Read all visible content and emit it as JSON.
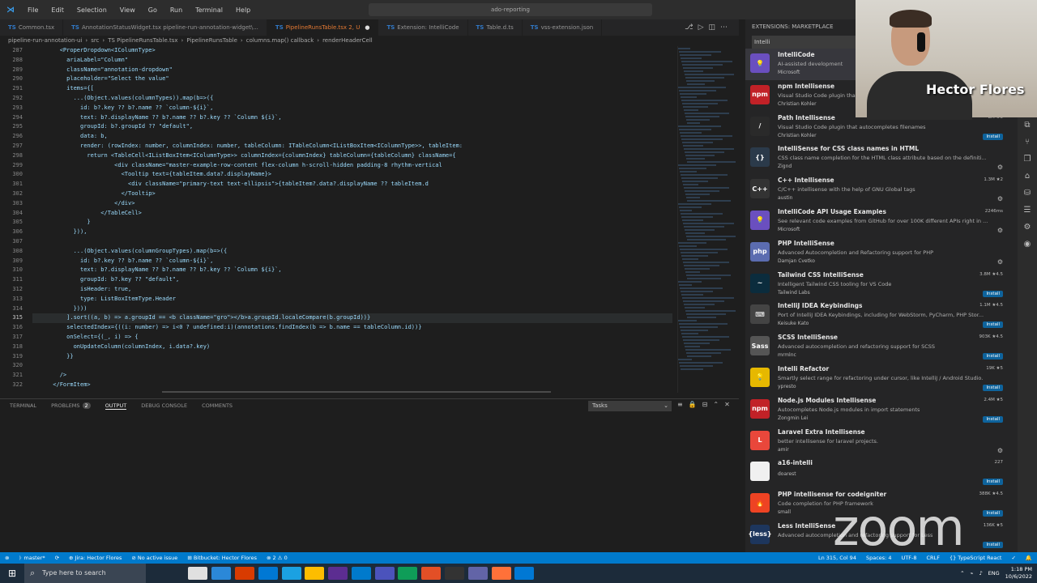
{
  "menubar": {
    "items": [
      "File",
      "Edit",
      "Selection",
      "View",
      "Go",
      "Run",
      "Terminal",
      "Help"
    ],
    "search": "ado-reporting",
    "nav": [
      "←",
      "→"
    ]
  },
  "tabs": [
    {
      "label": "Common.tsx",
      "state": "dot"
    },
    {
      "label": "AnnotationStatusWidget.tsx  pipeline-run-annotation-widget\\..."
    },
    {
      "label": "PipelineRunsTable.tsx 2, U",
      "active": true
    },
    {
      "label": "Extension: IntelliCode"
    },
    {
      "label": "Table.d.ts"
    },
    {
      "label": "vss-extension.json"
    }
  ],
  "breadcrumb": [
    "pipeline-run-annotation-ui",
    "›",
    "src",
    "›",
    "TS PipelineRunsTable.tsx",
    "›",
    "PipelineRunsTable",
    "›",
    "columns.map() callback",
    "›",
    "renderHeaderCell"
  ],
  "code_lines": [
    {
      "n": "287",
      "t": "        <ProperDropdown<IColumnType>"
    },
    {
      "n": "288",
      "t": "          ariaLabel=\"Column\""
    },
    {
      "n": "289",
      "t": "          className=\"annotation-dropdown\""
    },
    {
      "n": "290",
      "t": "          placeholder=\"Select the value\""
    },
    {
      "n": "291",
      "t": "          items={["
    },
    {
      "n": "292",
      "t": "            ...(Object.values(columnTypes)).map(b=>({"
    },
    {
      "n": "293",
      "t": "              id: b?.key ?? b?.name ?? `column-${i}`,"
    },
    {
      "n": "294",
      "t": "              text: b?.displayName ?? b?.name ?? b?.key ?? `Column ${i}`,"
    },
    {
      "n": "295",
      "t": "              groupId: b?.groupId ?? \"default\","
    },
    {
      "n": "296",
      "t": "              data: b,"
    },
    {
      "n": "297",
      "t": "              render: (rowIndex: number, columnIndex: number, tableColumn: ITableColumn<IListBoxItem<IColumnType>>, tableItem:"
    },
    {
      "n": "298",
      "t": "                return <TableCell<IListBoxItem<IColumnType>> columnIndex={columnIndex} tableColumn={tableColumn} className={"
    },
    {
      "n": "299",
      "t": "                        <div className=\"master-example-row-content flex-column h-scroll-hidden padding-8 rhythm-vertical"
    },
    {
      "n": "300",
      "t": "                          <Tooltip text={tableItem.data?.displayName}>"
    },
    {
      "n": "301",
      "t": "                            <div className=\"primary-text text-ellipsis\">{tableItem?.data?.displayName ?? tableItem.d"
    },
    {
      "n": "302",
      "t": "                          </Tooltip>"
    },
    {
      "n": "303",
      "t": "                        </div>"
    },
    {
      "n": "304",
      "t": "                    </TableCell>"
    },
    {
      "n": "305",
      "t": "                }"
    },
    {
      "n": "306",
      "t": "            })),"
    },
    {
      "n": "307",
      "t": ""
    },
    {
      "n": "308",
      "t": "            ...(Object.values(columnGroupTypes).map(b=>({"
    },
    {
      "n": "309",
      "t": "              id: b?.key ?? b?.name ?? `column-${i}`,"
    },
    {
      "n": "310",
      "t": "              text: b?.displayName ?? b?.name ?? b?.key ?? `Column ${i}`,"
    },
    {
      "n": "311",
      "t": "              groupId: b?.key ?? \"default\","
    },
    {
      "n": "312",
      "t": "              isHeader: true,"
    },
    {
      "n": "313",
      "t": "              type: ListBoxItemType.Header"
    },
    {
      "n": "314",
      "t": "            })))"
    },
    {
      "n": "315",
      "t": "          ].sort((a, b) => a.groupId == <b className=\"gro\"></b>a.groupId.localeCompare(b.groupId))}",
      "cur": true
    },
    {
      "n": "316",
      "t": "          selectedIndex={((i: number) => i<0 ? undefined:i)(annotations.findIndex(b => b.name == tableColumn.id))}"
    },
    {
      "n": "317",
      "t": "          onSelect={(_, i) => {"
    },
    {
      "n": "318",
      "t": "            onUpdateColumn(columnIndex, i.data?.key)"
    },
    {
      "n": "319",
      "t": "          }}"
    },
    {
      "n": "320",
      "t": ""
    },
    {
      "n": "321",
      "t": "        />"
    },
    {
      "n": "322",
      "t": "      </FormItem>"
    }
  ],
  "panel": {
    "tabs": [
      "TERMINAL",
      "PROBLEMS",
      "OUTPUT",
      "DEBUG CONSOLE",
      "COMMENTS"
    ],
    "problems_count": "2",
    "active": "OUTPUT",
    "task_select": "Tasks"
  },
  "extensions": {
    "title": "EXTENSIONS: MARKETPLACE",
    "search": "Intelli",
    "items": [
      {
        "name": "IntelliCode",
        "desc": "AI-assisted development",
        "pub": "Microsoft",
        "color": "#6a4fbf",
        "glyph": "💡",
        "selected": true,
        "stats": ""
      },
      {
        "name": "npm Intellisense",
        "desc": "Visual Studio Code plugin that autocompletes npm modules in import statements",
        "pub": "Christian Kohler",
        "color": "#c12127",
        "glyph": "npm",
        "stats": ""
      },
      {
        "name": "Path Intellisense",
        "desc": "Visual Studio Code plugin that autocompletes filenames",
        "pub": "Christian Kohler",
        "color": "#2a2a2a",
        "glyph": "/",
        "stats": "8M ★5",
        "install": "Install"
      },
      {
        "name": "IntelliSense for CSS class names in HTML",
        "desc": "CSS class name completion for the HTML class attribute based on the definiti...",
        "pub": "Zignd",
        "color": "#2b3a4a",
        "glyph": "{}",
        "stats": ""
      },
      {
        "name": "C++ Intellisense",
        "desc": "C/C++ intellisense with the help of GNU Global tags",
        "pub": "austin",
        "color": "#333",
        "glyph": "C++",
        "stats": "1.3M ★2"
      },
      {
        "name": "IntelliCode API Usage Examples",
        "desc": "See relevant code examples from GitHub for over 100K different APIs right in ...",
        "pub": "Microsoft",
        "color": "#6a4fbf",
        "glyph": "💡",
        "stats": "2246ms"
      },
      {
        "name": "PHP IntelliSense",
        "desc": "Advanced Autocompletion and Refactoring support for PHP",
        "pub": "Damjan Cvetko",
        "color": "#5b6cb0",
        "glyph": "php",
        "stats": ""
      },
      {
        "name": "Tailwind CSS IntelliSense",
        "desc": "Intelligent Tailwind CSS tooling for VS Code",
        "pub": "Tailwind Labs",
        "color": "#0b2c3d",
        "glyph": "~",
        "stats": "3.8M ★4.5",
        "install": "Install"
      },
      {
        "name": "IntelliJ IDEA Keybindings",
        "desc": "Port of IntelliJ IDEA Keybindings, including for WebStorm, PyCharm, PHP Stor...",
        "pub": "Keisuke Kato",
        "color": "#444",
        "glyph": "⌨",
        "stats": "1.1M ★4.5",
        "install": "Install"
      },
      {
        "name": "SCSS IntelliSense",
        "desc": "Advanced autocompletion and refactoring support for SCSS",
        "pub": "mrmlnc",
        "color": "#555",
        "glyph": "Sass",
        "stats": "903K ★4.5",
        "install": "Install"
      },
      {
        "name": "Intelli Refactor",
        "desc": "Smartly select range for refactoring under cursor, like IntelliJ / Android Studio.",
        "pub": "ypresto",
        "color": "#e6b800",
        "glyph": "💡",
        "stats": "19K ★5",
        "install": "Install"
      },
      {
        "name": "Node.js Modules Intellisense",
        "desc": "Autocompletes Node.js modules in import statements",
        "pub": "Zongmin Lei",
        "color": "#c12127",
        "glyph": "npm",
        "stats": "2.4M ★5",
        "install": "Install"
      },
      {
        "name": "Laravel Extra Intellisense",
        "desc": "better intellisense for laravel projects.",
        "pub": "amir",
        "color": "#e9473b",
        "glyph": "L",
        "stats": ""
      },
      {
        "name": "a16-intelli",
        "desc": "",
        "pub": "doarest",
        "color": "#f0f0f0",
        "glyph": "",
        "stats": "227",
        "install": "Install"
      },
      {
        "name": "PHP intellisense for codeigniter",
        "desc": "Code completion for PHP framework",
        "pub": "small",
        "color": "#ee4323",
        "glyph": "🔥",
        "stats": "388K ★4.5",
        "install": "Install"
      },
      {
        "name": "Less IntelliSense",
        "desc": "Advanced autocompletion and refactoring support for Less",
        "pub": "",
        "color": "#1d365d",
        "glyph": "{less}",
        "stats": "136K ★5",
        "install": "Install"
      }
    ]
  },
  "webcam": {
    "name": "Hector Flores"
  },
  "statusbar": {
    "left": [
      "⊗",
      "ᚦ master*",
      "⟳",
      "⊕ Jira: Hector Flores",
      "⊘ No active issue",
      "⊞ Bitbucket: Hector Flores",
      "⊗ 2 ⚠ 0"
    ],
    "right": [
      "Ln 315, Col 94",
      "Spaces: 4",
      "UTF-8",
      "CRLF",
      "{} TypeScript React",
      "✓",
      "🔔"
    ]
  },
  "taskbar": {
    "search": "Type here to search",
    "lang": "ENG",
    "time": "1:18 PM",
    "date": "10/6/2022"
  },
  "colors": {
    "accent": "#007acc",
    "install": "#0e639c",
    "active_tab": "#e37933"
  },
  "watermark": "zoom"
}
